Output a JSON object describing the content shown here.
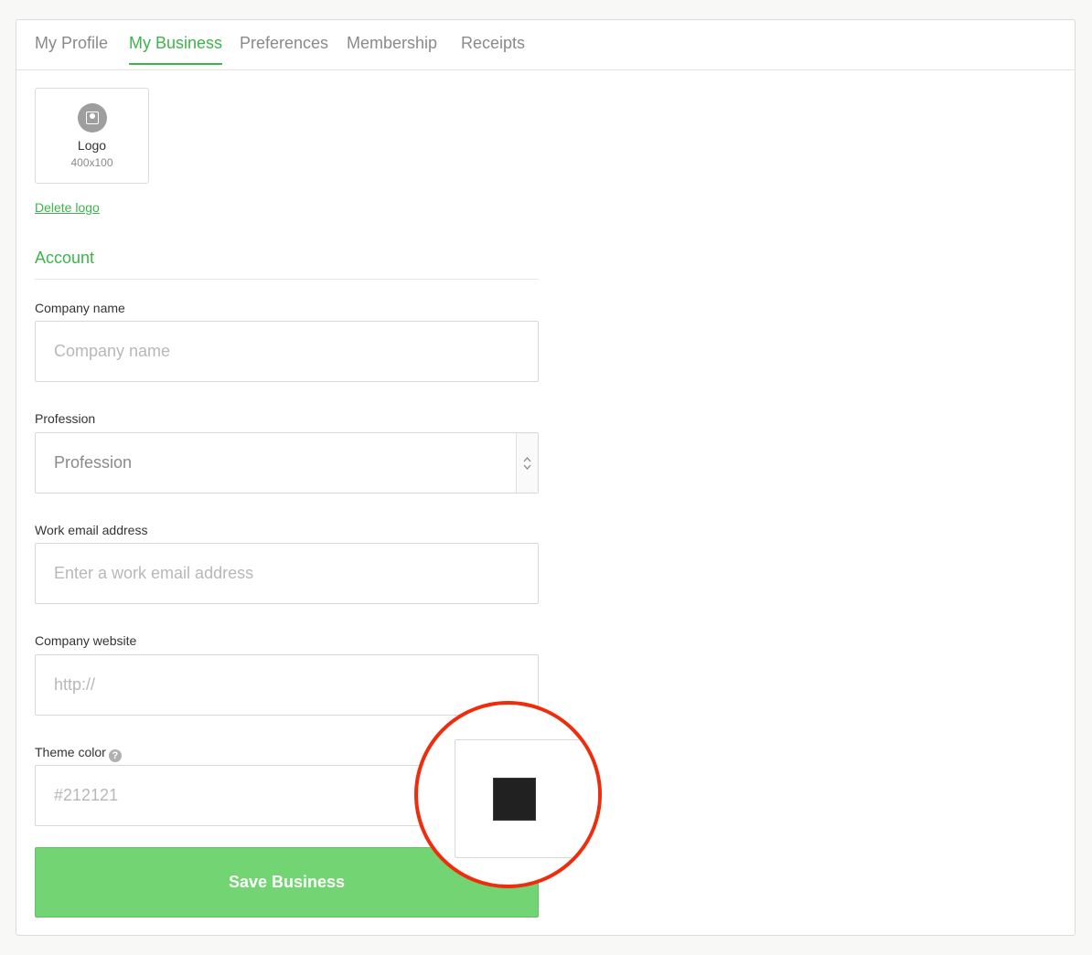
{
  "tabs": [
    {
      "label": "My Profile",
      "active": false
    },
    {
      "label": "My Business",
      "active": true
    },
    {
      "label": "Preferences",
      "active": false
    },
    {
      "label": "Membership",
      "active": false
    },
    {
      "label": "Receipts",
      "active": false
    }
  ],
  "logo": {
    "title": "Logo",
    "size": "400x100",
    "icon": "image-icon"
  },
  "delete_logo": "Delete logo",
  "section": {
    "title": "Account"
  },
  "fields": {
    "company_name": {
      "label": "Company name",
      "placeholder": "Company name",
      "value": ""
    },
    "profession": {
      "label": "Profession",
      "value": "Profession"
    },
    "work_email": {
      "label": "Work email address",
      "placeholder": "Enter a work email address",
      "value": ""
    },
    "website": {
      "label": "Company website",
      "placeholder": "http://",
      "value": ""
    },
    "theme_color": {
      "label": "Theme color",
      "help_icon": "?",
      "placeholder": "#212121",
      "value": ""
    }
  },
  "theme_swatch_color": "#212121",
  "save_button": "Save Business",
  "colors": {
    "accent": "#3cb54a",
    "button": "#72d473",
    "highlight": "#f02c0e"
  }
}
